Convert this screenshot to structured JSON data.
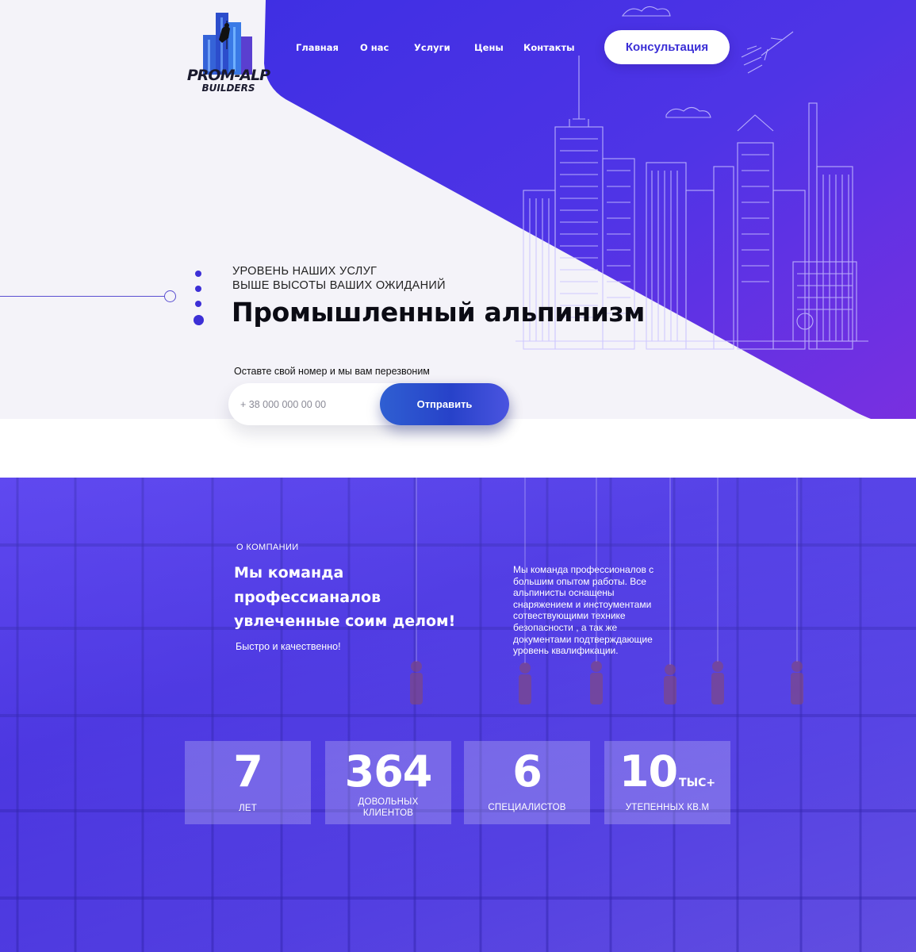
{
  "brand": {
    "logo_line1": "PROM-ALP",
    "logo_line2": "BUILDERS"
  },
  "nav": {
    "items": [
      "Главная",
      "О нас",
      "Услуги",
      "Цены",
      "Контакты"
    ],
    "cta_label": "Консультация"
  },
  "hero": {
    "subtitle_line1": "УРОВЕНЬ НАШИХ УСЛУГ",
    "subtitle_line2": "ВЫШЕ ВЫСОТЫ ВАШИХ ОЖИДАНИЙ",
    "title": "Промышленный альпинизм",
    "callback_label": "Оставте свой номер и мы вам перезвоним",
    "phone_placeholder": "+ 38 000 000 00 00",
    "submit_label": "Отправить"
  },
  "about": {
    "label": "О КОМПАНИИ",
    "title_lines": [
      "Мы команда",
      "профессианалов",
      "увлеченные соим делом!"
    ],
    "subtitle": "Быстро и качественно!",
    "description_lines": [
      "Мы команда профессионалов  с",
      "большим опытом работы. Все",
      "альпинисты оснащены",
      "снаряжением и инстоументами",
      "сотвествующими технике",
      "безопасности , а так же",
      "документами подтверждающие",
      "уровень квалификации."
    ]
  },
  "stats": [
    {
      "value": "7",
      "suffix": "",
      "caption_lines": [
        "ЛЕТ"
      ]
    },
    {
      "value": "364",
      "suffix": "",
      "caption_lines": [
        "ДОВОЛЬНЫХ",
        "КЛИЕНТОВ"
      ]
    },
    {
      "value": "6",
      "suffix": "",
      "caption_lines": [
        "СПЕЦИАЛИСТОВ"
      ]
    },
    {
      "value": "10",
      "suffix": "ТЫС+",
      "caption_lines": [
        "УТЕПЕННЫХ КВ.М"
      ]
    }
  ],
  "colors": {
    "accent": "#3c2fd6",
    "hero_gradient_start": "#4a2fe0",
    "hero_gradient_end": "#7a35e8",
    "button_blue": "#2f5fd2"
  }
}
